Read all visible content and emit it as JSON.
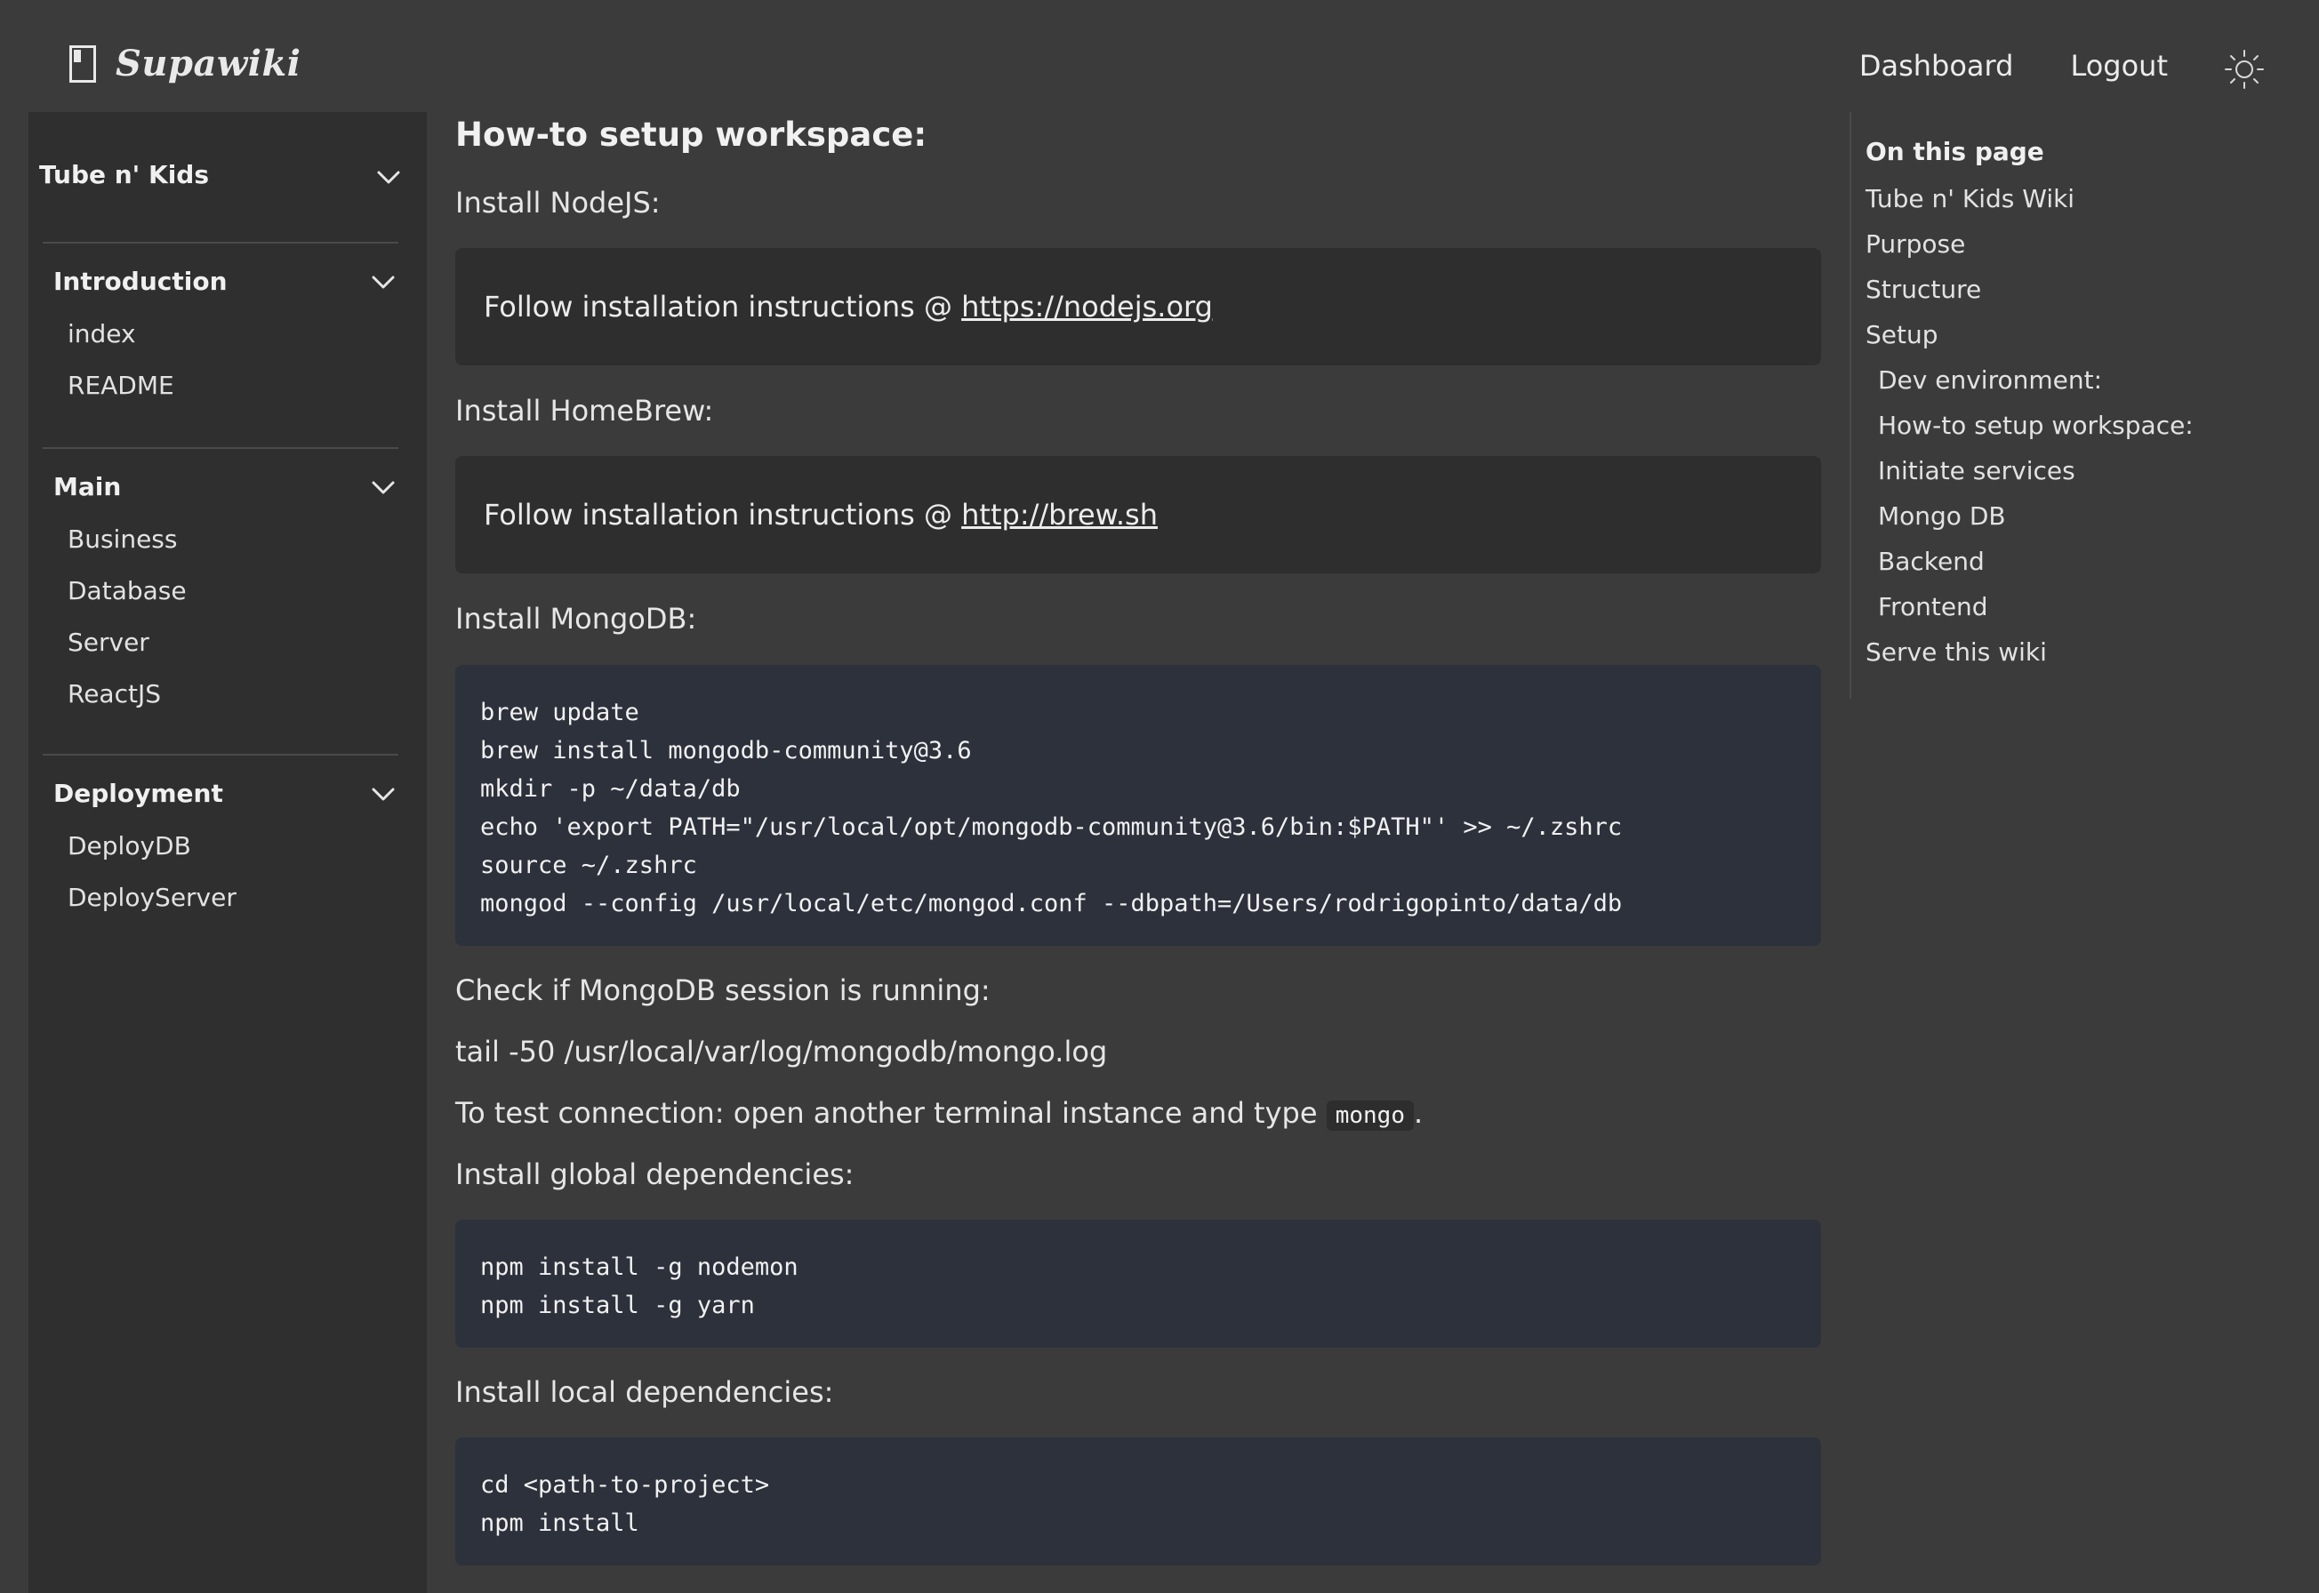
{
  "header": {
    "brand": "Supawiki",
    "nav": [
      "Dashboard",
      "Logout"
    ]
  },
  "sidebar": {
    "project": "Tube n' Kids",
    "sections": [
      {
        "title": "Introduction",
        "items": [
          "index",
          "README"
        ]
      },
      {
        "title": "Main",
        "items": [
          "Business",
          "Database",
          "Server",
          "ReactJS"
        ]
      },
      {
        "title": "Deployment",
        "items": [
          "DeployDB",
          "DeployServer"
        ]
      }
    ]
  },
  "main": {
    "heading": "How-to setup workspace:",
    "install_node": "Install NodeJS:",
    "node_note_prefix": "Follow installation instructions @ ",
    "node_link": "https://nodejs.org",
    "install_brew": "Install HomeBrew:",
    "brew_note_prefix": "Follow installation instructions @ ",
    "brew_link": "http://brew.sh",
    "install_mongo": "Install MongoDB:",
    "mongo_code": [
      "brew update",
      "brew install mongodb-community@3.6",
      "mkdir -p ~/data/db",
      "echo 'export PATH=\"/usr/local/opt/mongodb-community@3.6/bin:$PATH\"' >> ~/.zshrc",
      "source ~/.zshrc",
      "mongod --config /usr/local/etc/mongod.conf --dbpath=/Users/rodrigopinto/data/db"
    ],
    "check_mongo": "Check if MongoDB session is running:",
    "tail_cmd": "tail -50 /usr/local/var/log/mongodb/mongo.log",
    "test_conn_prefix": "To test connection: open another terminal instance and type ",
    "test_conn_code": "mongo",
    "test_conn_suffix": ".",
    "install_global": "Install global dependencies:",
    "global_code": [
      "npm install -g nodemon",
      "npm install -g yarn"
    ],
    "install_local": "Install local dependencies:",
    "local_code": [
      "cd <path-to-project>",
      "npm install"
    ]
  },
  "toc": {
    "title": "On this page",
    "items": [
      {
        "label": "Tube n' Kids Wiki",
        "level": 1
      },
      {
        "label": "Purpose",
        "level": 1
      },
      {
        "label": "Structure",
        "level": 1
      },
      {
        "label": "Setup",
        "level": 1
      },
      {
        "label": "Dev environment:",
        "level": 2
      },
      {
        "label": "How-to setup workspace:",
        "level": 2
      },
      {
        "label": "Initiate services",
        "level": 2
      },
      {
        "label": "Mongo DB",
        "level": 2
      },
      {
        "label": "Backend",
        "level": 2
      },
      {
        "label": "Frontend",
        "level": 2
      },
      {
        "label": "Serve this wiki",
        "level": 1
      }
    ]
  }
}
